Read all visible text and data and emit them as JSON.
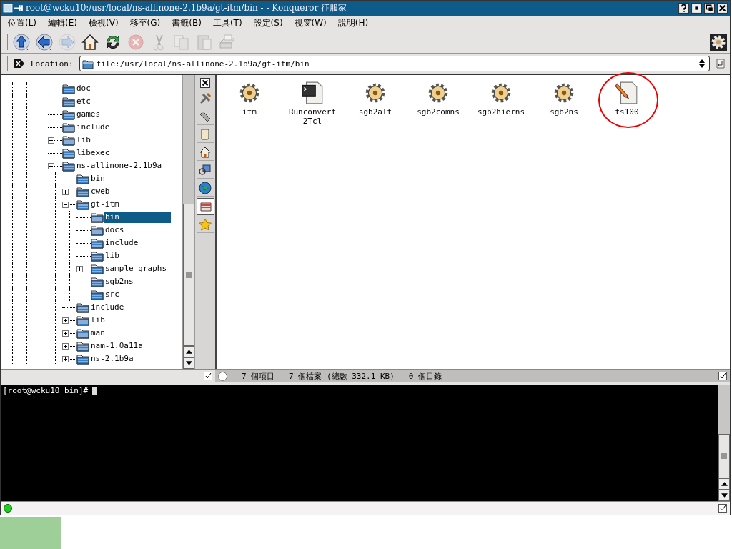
{
  "window": {
    "title": "root@wcku10:/usr/local/ns-allinone-2.1b9a/gt-itm/bin -  - Konqueror 征服家"
  },
  "menu": [
    "位置(L)",
    "編輯(E)",
    "檢視(V)",
    "移至(G)",
    "書籤(B)",
    "工具(T)",
    "設定(S)",
    "視窗(W)",
    "說明(H)"
  ],
  "toolbar": [
    {
      "kind": "up",
      "disabled": false
    },
    {
      "kind": "back",
      "disabled": false
    },
    {
      "kind": "forward",
      "disabled": true
    },
    {
      "kind": "home",
      "disabled": false
    },
    {
      "kind": "reload",
      "disabled": false
    },
    {
      "kind": "stop",
      "disabled": true
    },
    {
      "kind": "cut",
      "disabled": true
    },
    {
      "kind": "copy",
      "disabled": true
    },
    {
      "kind": "paste",
      "disabled": true
    },
    {
      "kind": "print",
      "disabled": true
    }
  ],
  "location": {
    "label": "Location:",
    "value": "file:/usr/local/ns-allinone-2.1b9a/gt-itm/bin"
  },
  "tree": [
    {
      "label": "doc",
      "selected": false
    },
    {
      "label": "etc",
      "selected": false
    },
    {
      "label": "games",
      "selected": false
    },
    {
      "label": "include",
      "selected": false
    },
    {
      "label": "lib",
      "expanded": false,
      "selected": false
    },
    {
      "label": "libexec",
      "selected": false
    },
    {
      "label": "ns-allinone-2.1b9a",
      "expanded": true,
      "selected": false,
      "children": [
        {
          "label": "bin",
          "selected": false
        },
        {
          "label": "cweb",
          "expanded": false,
          "selected": false
        },
        {
          "label": "gt-itm",
          "expanded": true,
          "selected": false,
          "children": [
            {
              "label": "bin",
              "selected": true
            },
            {
              "label": "docs",
              "selected": false
            },
            {
              "label": "include",
              "selected": false
            },
            {
              "label": "lib",
              "selected": false
            },
            {
              "label": "sample-graphs",
              "expanded": false,
              "selected": false
            },
            {
              "label": "sgb2ns",
              "selected": false
            },
            {
              "label": "src",
              "selected": false
            }
          ]
        },
        {
          "label": "include",
          "selected": false
        },
        {
          "label": "lib",
          "expanded": false,
          "selected": false
        },
        {
          "label": "man",
          "expanded": false,
          "selected": false
        },
        {
          "label": "nam-1.0a11a",
          "expanded": false,
          "selected": false
        },
        {
          "label": "ns-2.1b9a",
          "expanded": false,
          "selected": false
        }
      ]
    }
  ],
  "sidebar_tabs": [
    {
      "kind": "tools",
      "selected": false
    },
    {
      "kind": "ruler",
      "selected": false
    },
    {
      "kind": "scroll",
      "selected": false
    },
    {
      "kind": "home",
      "selected": false
    },
    {
      "kind": "network",
      "selected": false
    },
    {
      "kind": "globe",
      "selected": false
    },
    {
      "kind": "folder",
      "selected": true
    },
    {
      "kind": "star",
      "selected": false
    }
  ],
  "files": [
    {
      "name": "itm",
      "kind": "gear",
      "highlighted": false
    },
    {
      "name": "Runconvert2Tcl",
      "kind": "script",
      "highlighted": false
    },
    {
      "name": "sgb2alt",
      "kind": "gear",
      "highlighted": false
    },
    {
      "name": "sgb2comns",
      "kind": "gear",
      "highlighted": false
    },
    {
      "name": "sgb2hierns",
      "kind": "gear",
      "highlighted": false
    },
    {
      "name": "sgb2ns",
      "kind": "gear",
      "highlighted": false
    },
    {
      "name": "ts100",
      "kind": "text",
      "highlighted": true
    }
  ],
  "status_bar": "7 個項目 - 7 個檔案 (總數 332.1 KB) - 0 個目錄",
  "terminal": {
    "prompt": "[root@wcku10 bin]#"
  }
}
